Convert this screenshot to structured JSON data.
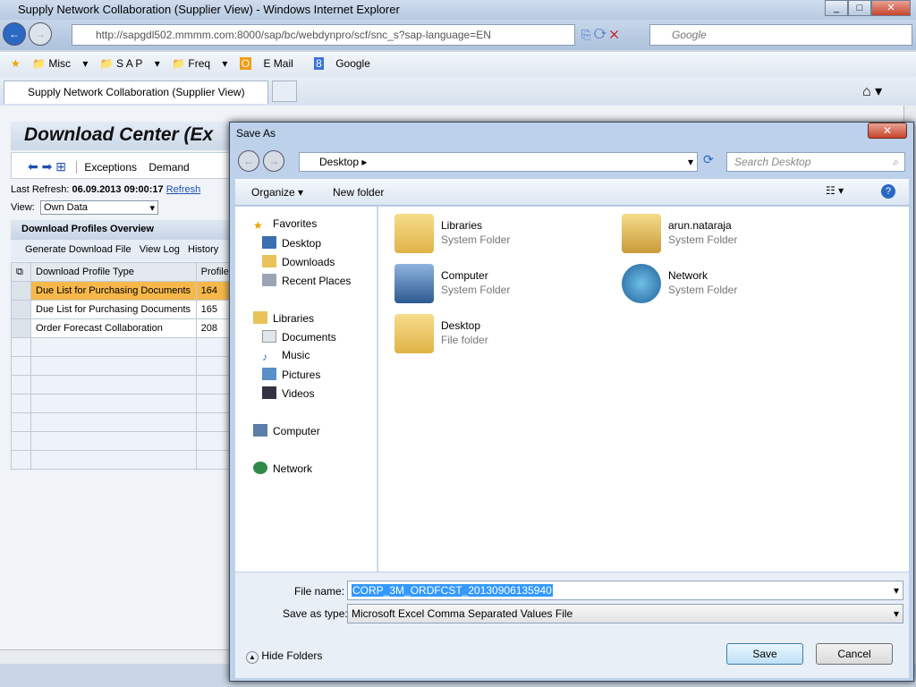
{
  "browser": {
    "title": "Supply Network Collaboration (Supplier View) - Windows Internet Explorer",
    "url": "http://sapgdl502.mmmm.com:8000/sap/bc/webdynpro/scf/snc_s?sap-language=EN",
    "search_placeholder": "Google",
    "tab_title": "Supply Network Collaboration (Supplier View)",
    "favorites": [
      "Misc",
      "S A P",
      "Freq",
      "E Mail",
      "Google"
    ]
  },
  "app": {
    "title": "Download Center (Ex",
    "toolbar": [
      "Exceptions",
      "Demand"
    ],
    "last_refresh_label": "Last Refresh:",
    "last_refresh_value": "06.09.2013 09:00:17",
    "refresh_link": "Refresh",
    "view_label": "View:",
    "view_value": "Own Data",
    "panel_title": "Download Profiles Overview",
    "panel_actions": [
      "Generate Download File",
      "View Log",
      "History"
    ],
    "columns": [
      "Download Profile Type",
      "Profile"
    ],
    "rows": [
      {
        "type": "Due List for Purchasing Documents",
        "profile": "164",
        "selected": true
      },
      {
        "type": "Due List for Purchasing Documents",
        "profile": "165"
      },
      {
        "type": "Order Forecast Collaboration",
        "profile": "208"
      }
    ]
  },
  "dialog": {
    "title": "Save As",
    "path": "Desktop",
    "search_placeholder": "Search Desktop",
    "organize": "Organize",
    "new_folder": "New folder",
    "nav": {
      "favorites": "Favorites",
      "fav_items": [
        "Desktop",
        "Downloads",
        "Recent Places"
      ],
      "libraries": "Libraries",
      "lib_items": [
        "Documents",
        "Music",
        "Pictures",
        "Videos"
      ],
      "computer": "Computer",
      "network": "Network"
    },
    "items": [
      {
        "name": "Libraries",
        "type": "System Folder"
      },
      {
        "name": "arun.nataraja",
        "type": "System Folder"
      },
      {
        "name": "Computer",
        "type": "System Folder"
      },
      {
        "name": "Network",
        "type": "System Folder"
      },
      {
        "name": "Desktop",
        "type": "File folder"
      }
    ],
    "file_name_label": "File name:",
    "file_name": "CORP_3M_ORDFCST_20130906135940",
    "save_type_label": "Save as type:",
    "save_type": "Microsoft Excel Comma Separated Values File",
    "hide_folders": "Hide Folders",
    "save": "Save",
    "cancel": "Cancel"
  }
}
